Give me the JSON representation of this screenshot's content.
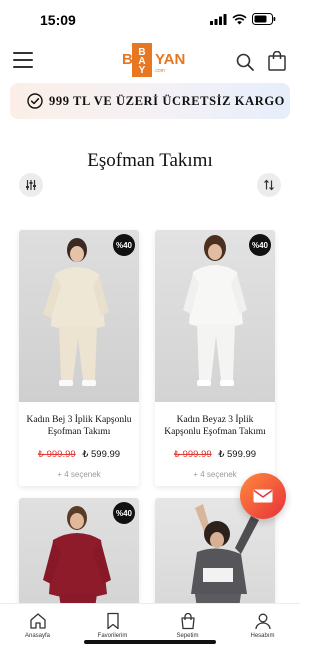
{
  "status": {
    "time": "15:09"
  },
  "logo": {
    "first_letter": "B",
    "vertical": "BAY",
    "rest": "YAN",
    "domain": ".com"
  },
  "promo": {
    "text": "999 TL VE ÜZERİ ÜCRETSİZ KARGO",
    "icon": "check-circle-icon"
  },
  "page": {
    "title": "Eşofman Takımı"
  },
  "colors": {
    "brand": "#e87722",
    "old_price": "#e53935",
    "fab_from": "#ff8a3d",
    "fab_to": "#e8303a"
  },
  "products": [
    {
      "badge": "%40",
      "name": "Kadın Bej 3 İplik Kapşonlu Eşofman Takımı",
      "old_price": "₺ 999.99",
      "new_price": "₺ 599.99",
      "options": "+ 4 seçenek",
      "color_desc": "beige"
    },
    {
      "badge": "%40",
      "name": "Kadın Beyaz 3 İplik Kapşonlu Eşofman Takımı",
      "old_price": "₺ 999.99",
      "new_price": "₺ 599.99",
      "options": "+ 4 seçenek",
      "color_desc": "white"
    },
    {
      "badge": "%40",
      "name": "",
      "color_desc": "burgundy"
    },
    {
      "badge": "",
      "name": "",
      "color_desc": "grey"
    }
  ],
  "nav": [
    {
      "label": "Anasayfa",
      "icon": "home-icon"
    },
    {
      "label": "Favorilerim",
      "icon": "bookmark-icon"
    },
    {
      "label": "Sepetim",
      "icon": "shopping-bag-icon"
    },
    {
      "label": "Hesabım",
      "icon": "user-icon"
    }
  ]
}
